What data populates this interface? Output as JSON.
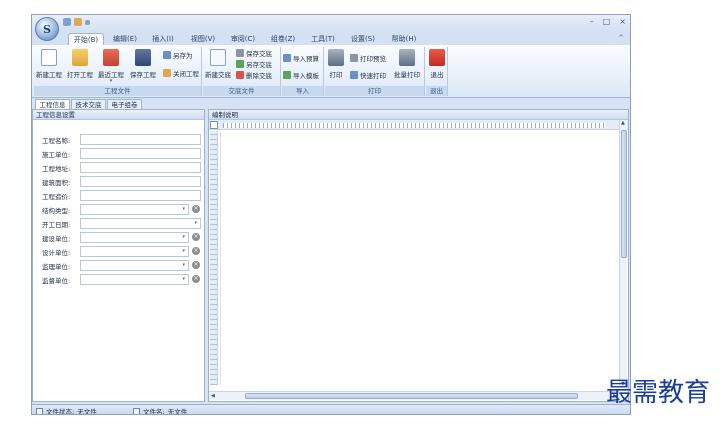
{
  "window": {
    "controls": [
      "–",
      "□",
      "×"
    ]
  },
  "app_orb": {
    "glyph": "S"
  },
  "ribbon_tabs": [
    {
      "label": "开始(B)",
      "active": true
    },
    {
      "label": "编辑(E)"
    },
    {
      "label": "插入(I)"
    },
    {
      "label": "视图(V)"
    },
    {
      "label": "审阅(C)"
    },
    {
      "label": "组卷(Z)"
    },
    {
      "label": "工具(T)"
    },
    {
      "label": "设置(S)"
    },
    {
      "label": "帮助(H)"
    }
  ],
  "ribbon_collapse": "^",
  "groups": {
    "project": {
      "label": "工程文件",
      "new": "新建工程",
      "open": "打开工程",
      "recent": "最近工程",
      "save": "保存工程",
      "save_as": "另存为",
      "close": "关闭工程"
    },
    "doc": {
      "label": "交底文件",
      "new": "新建交底",
      "save": "保存交底",
      "save_as": "另存交底",
      "delete": "删除交底"
    },
    "import": {
      "label": "导入",
      "budget": "导入预算",
      "template": "导入模板"
    },
    "print": {
      "label": "打印",
      "print": "打印",
      "preview": "打印预览",
      "quick": "快速打印",
      "batch": "批量打印"
    },
    "exit": {
      "label": "退出",
      "exit": "退出"
    }
  },
  "doc_tabs": [
    {
      "label": "工程信息",
      "active": true
    },
    {
      "label": "技术交底"
    },
    {
      "label": "电子组卷"
    }
  ],
  "left_panel": {
    "title": "工程信息设置",
    "fields": [
      {
        "label": "工程名称:",
        "type": "text",
        "value": ""
      },
      {
        "label": "施工单位:",
        "type": "text",
        "value": ""
      },
      {
        "label": "工程地址:",
        "type": "text",
        "value": ""
      },
      {
        "label": "建筑面积:",
        "type": "text",
        "value": ""
      },
      {
        "label": "工程造价:",
        "type": "text",
        "value": ""
      },
      {
        "label": "结构类型:",
        "type": "combo-clear",
        "value": ""
      },
      {
        "label": "开工日期:",
        "type": "combo",
        "value": ""
      },
      {
        "label": "建设单位:",
        "type": "combo-clear",
        "value": ""
      },
      {
        "label": "设计单位:",
        "type": "combo-clear",
        "value": ""
      },
      {
        "label": "监理单位:",
        "type": "combo-clear",
        "value": ""
      },
      {
        "label": "监督单位:",
        "type": "combo-clear",
        "value": ""
      }
    ]
  },
  "editor": {
    "title": "编制说明"
  },
  "statusbar": {
    "file_status_label": "文件状态:",
    "file_status_value": "无文件",
    "file_name_label": "文件名:",
    "file_name_value": "无文件"
  },
  "watermark": "最需教育"
}
